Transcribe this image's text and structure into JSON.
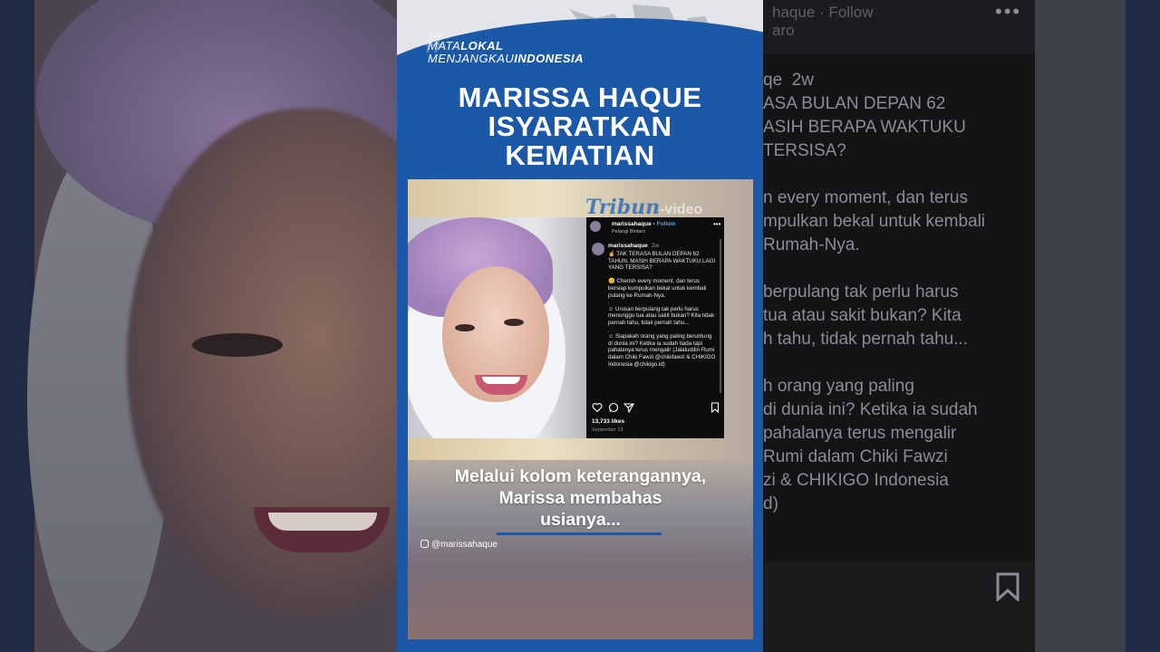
{
  "brand": {
    "line1_normal": "MATA",
    "line1_bold": "LOKAL",
    "line2_normal": "MENJANGKAU",
    "line2_bold": "INDONESIA"
  },
  "headline": {
    "line1": "MARISSA HAQUE",
    "line2": "ISYARATKAN",
    "line3": "KEMATIAN"
  },
  "watermark": {
    "brand": "Tribun",
    "suffix": "-video"
  },
  "instagram_post": {
    "username": "marissahaque",
    "follow_label": "• Follow",
    "location": "Pelangi Bintaro",
    "more_icon": "more-horizontal-icon",
    "comment_username": "marissahaque",
    "comment_age": "2w",
    "caption": "☝️ TAK TERASA BULAN DEPAN 62 TAHUN, MASIH BERAPA WAKTUKU LAGI YANG TERSISA?\n\n😊 Cherish every moment, dan terus bersiap kumpulkan bekal untuk kembali pulang ke Rumah-Nya.\n.\n☺ Urusan berpulang tak perlu harus menunggu tua atau sakit bukan? Kita tidak pernah tahu, tidak pernah tahu...\n.\n☺ Siapakah orang yang paling beruntung di dunia ini? Ketika ia sudah tiada tapi pahalanya terus mengalir (Jalaluddin Rumi dalam Chiki Fawzi @chikifawzi & CHIKIGO Indonesia @chikigo.id)",
    "likes": "13,733 likes",
    "date": "September 19",
    "action_icons": [
      "heart-icon",
      "comment-icon",
      "share-icon",
      "bookmark-icon"
    ]
  },
  "caption": {
    "line1": "Melalui kolom keterangannya,",
    "line2": "Marissa membahas",
    "line3": "usianya..."
  },
  "credit": {
    "handle": "@marissahaque"
  },
  "right_bg": {
    "top": "haque · Follow\naro",
    "text": "qe  2w\nASA BULAN DEPAN 62\nASIH BERAPA WAKTUKU\nTERSISA?\n\nn every moment, dan terus\nmpulkan bekal untuk kembali\nRumah-Nya.\n\nberpulang tak perlu harus\ntua atau sakit bukan? Kita\nh tahu, tidak pernah tahu...\n\nh orang yang paling\ndi dunia ini? Ketika ia sudah\npahalanya terus mengalir\nRumi dalam Chiki Fawzi\nzi & CHIKIGO Indonesia\nd)"
  },
  "colors": {
    "brand_blue": "#1b58a8",
    "ig_bg": "#0d0d0f",
    "ig_link": "#4aa3ff"
  }
}
